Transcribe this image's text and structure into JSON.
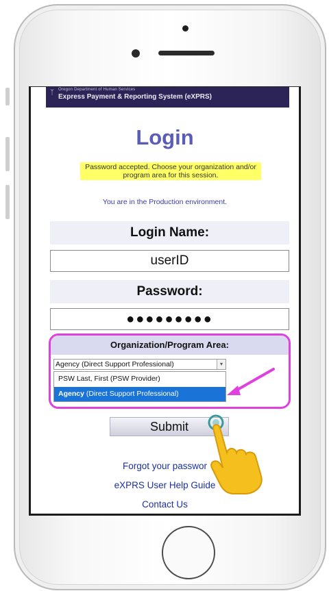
{
  "app": {
    "department": "Oregon Department of Human Services",
    "system_name": "Express Payment & Reporting System (eXPRS)"
  },
  "login": {
    "title": "Login",
    "notice": "Password accepted. Choose your organization and/or program area for this session.",
    "environment_text": "You are in the Production environment.",
    "login_name_label": "Login Name:",
    "login_name_value": "userID",
    "password_label": "Password:",
    "password_value": "●●●●●●●●●",
    "org_label": "Organization/Program Area:",
    "org_selected": "Agency  (Direct Support Professional)",
    "org_options": [
      {
        "label": "PSW Last, First",
        "role": "(PSW Provider)"
      },
      {
        "label": "Agency",
        "role": "(Direct Support Professional)"
      }
    ],
    "submit_label": "Submit"
  },
  "links": {
    "forgot_password": "Forgot your passwor",
    "help_guides": "eXPRS User Help Guide",
    "contact": "Contact Us"
  },
  "colors": {
    "banner": "#2c2357",
    "title": "#5b5bb8",
    "highlight": "#ffff66",
    "selected_option": "#1a73d6",
    "callout": "#e040e0",
    "link": "#1c2fa0"
  },
  "icons": {
    "logo": "oregon-dhs-logo-icon",
    "pointer": "hand-pointer-icon",
    "arrow": "magenta-arrow-icon"
  }
}
